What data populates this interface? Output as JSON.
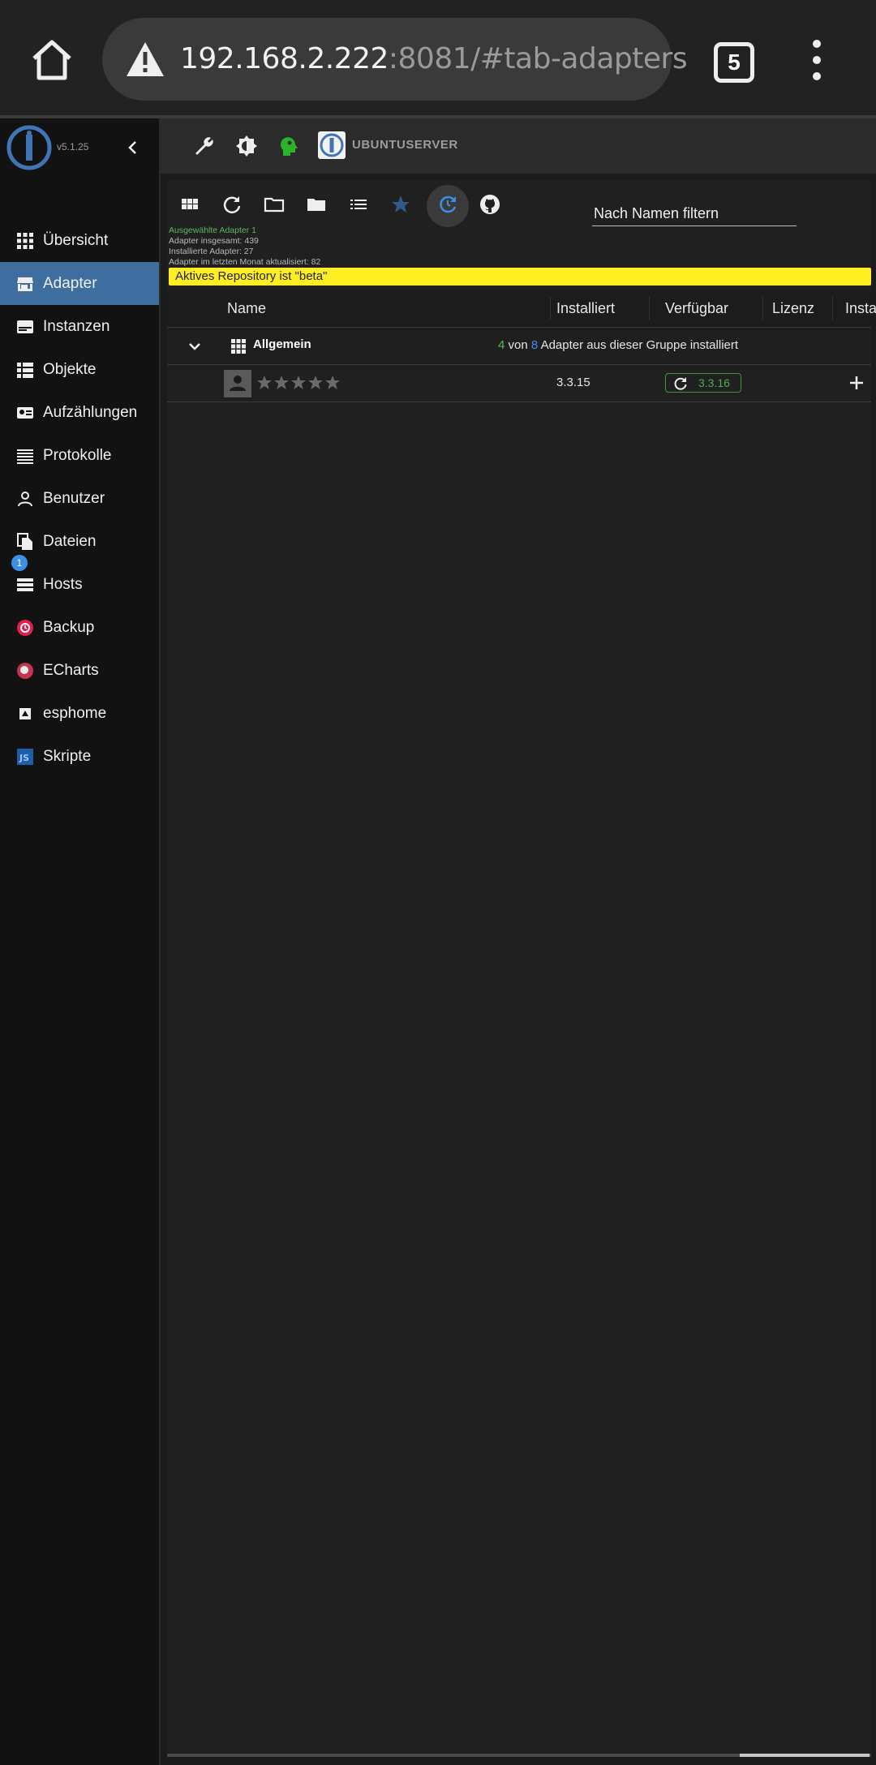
{
  "browser": {
    "url_host": "192.168.2.222",
    "url_rest": ":8081/#tab-adapters",
    "tab_count": "5"
  },
  "sidebar": {
    "version": "v5.1.25",
    "items": [
      {
        "label": "Übersicht",
        "icon": "grid-icon"
      },
      {
        "label": "Adapter",
        "icon": "store-icon",
        "active": true
      },
      {
        "label": "Instanzen",
        "icon": "instances-icon"
      },
      {
        "label": "Objekte",
        "icon": "list-icon"
      },
      {
        "label": "Aufzählungen",
        "icon": "enum-icon"
      },
      {
        "label": "Protokolle",
        "icon": "log-icon"
      },
      {
        "label": "Benutzer",
        "icon": "user-icon"
      },
      {
        "label": "Dateien",
        "icon": "files-icon"
      },
      {
        "label": "Hosts",
        "icon": "hosts-icon",
        "badge": "1"
      },
      {
        "label": "Backup",
        "icon": "backup-icon"
      },
      {
        "label": "ECharts",
        "icon": "echarts-icon"
      },
      {
        "label": "esphome",
        "icon": "esphome-icon"
      },
      {
        "label": "Skripte",
        "icon": "js-icon"
      }
    ]
  },
  "toolbar": {
    "host_label": "UBUNTUSERVER"
  },
  "main": {
    "filter_placeholder": "Nach Namen filtern",
    "stats": {
      "selected": "Ausgewählte Adapter 1",
      "total": "Adapter insgesamt: 439",
      "installed": "Installierte Adapter: 27",
      "updated": "Adapter im letzten Monat aktualisiert: 82"
    },
    "repo_banner": "Aktives Repository ist \"beta\"",
    "columns": [
      "Name",
      "Installiert",
      "Verfügbar",
      "Lizenz",
      "Insta"
    ],
    "group": {
      "name": "Allgemein",
      "installed_count": "4",
      "word_von": "von",
      "total_count": "8",
      "suffix": "Adapter aus dieser Gruppe installiert"
    },
    "adapter": {
      "installed": "3.3.15",
      "available": "3.3.16",
      "rating": 0
    }
  },
  "colors": {
    "active_nav": "#3e6ea0",
    "banner": "#ffee22",
    "green": "#5cb85c",
    "blue": "#3d8ee6"
  }
}
